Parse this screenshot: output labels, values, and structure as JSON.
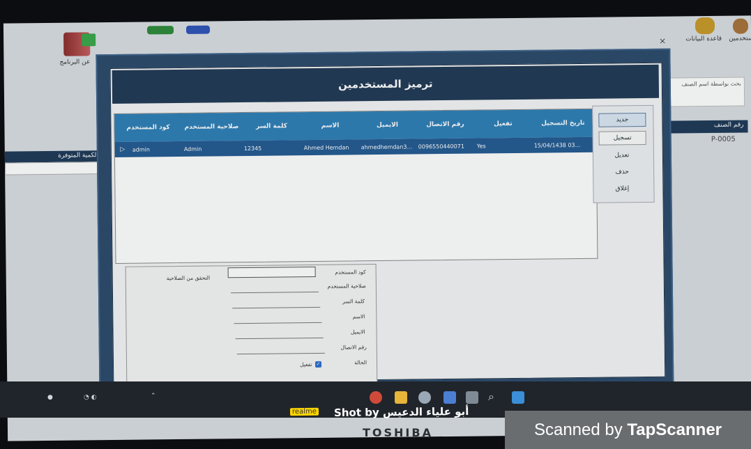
{
  "window": {
    "title": "ترميز المستخدمين",
    "close_glyph": "×"
  },
  "grid": {
    "columns": [
      "كود المستخدم",
      "صلاحية المستخدم",
      "كلمة السر",
      "الاسم",
      "الايميل",
      "رقم الاتصال",
      "تفعيل",
      "تاريخ التسجيل"
    ],
    "rows": [
      [
        "admin",
        "Admin",
        "12345",
        "Ahmed Hemdan",
        "ahmedhemdan3...",
        "0096550440071",
        "Yes",
        "15/04/1438 03..."
      ]
    ],
    "row_indicator": "▷"
  },
  "buttons": {
    "new": "جديد",
    "save": "تسجيل",
    "edit": "تعديل",
    "delete": "حذف",
    "close": "إغلاق"
  },
  "form": {
    "user_code_label": "كود المستخدم",
    "permission_label": "صلاحية المستخدم",
    "password_label": "كلمة السر",
    "name_label": "الاسم",
    "email_label": "الايميل",
    "phone_label": "رقم الاتصال",
    "status_label": "الحالة",
    "active_label": "تفعيل",
    "check_permission_label": "التحقق من الصلاحية"
  },
  "background": {
    "toolbar_left_label": "عن البرنامج",
    "toolbar_right_label1": "قاعدة البيانات",
    "toolbar_right_label2": "المستخدمين",
    "search_panel_text": "بحث بواسطة اسم الصنف",
    "product_no_label": "رقم الصنف",
    "product_no_value": "P-0005",
    "qty_label": "الكمية المتوفرة"
  },
  "overlay": {
    "realme_tag": "realme",
    "shot_by": "Shot by أبو علياء الدعيس",
    "toshiba": "TOSHIBA",
    "scanned_prefix": "Scanned by ",
    "scanned_brand": "TapScanner"
  },
  "colors": {
    "title_bar": "#223a56",
    "grid_header": "#2f7fb7",
    "selected_row": "#245b92",
    "window_frame": "#2c4a6c"
  }
}
